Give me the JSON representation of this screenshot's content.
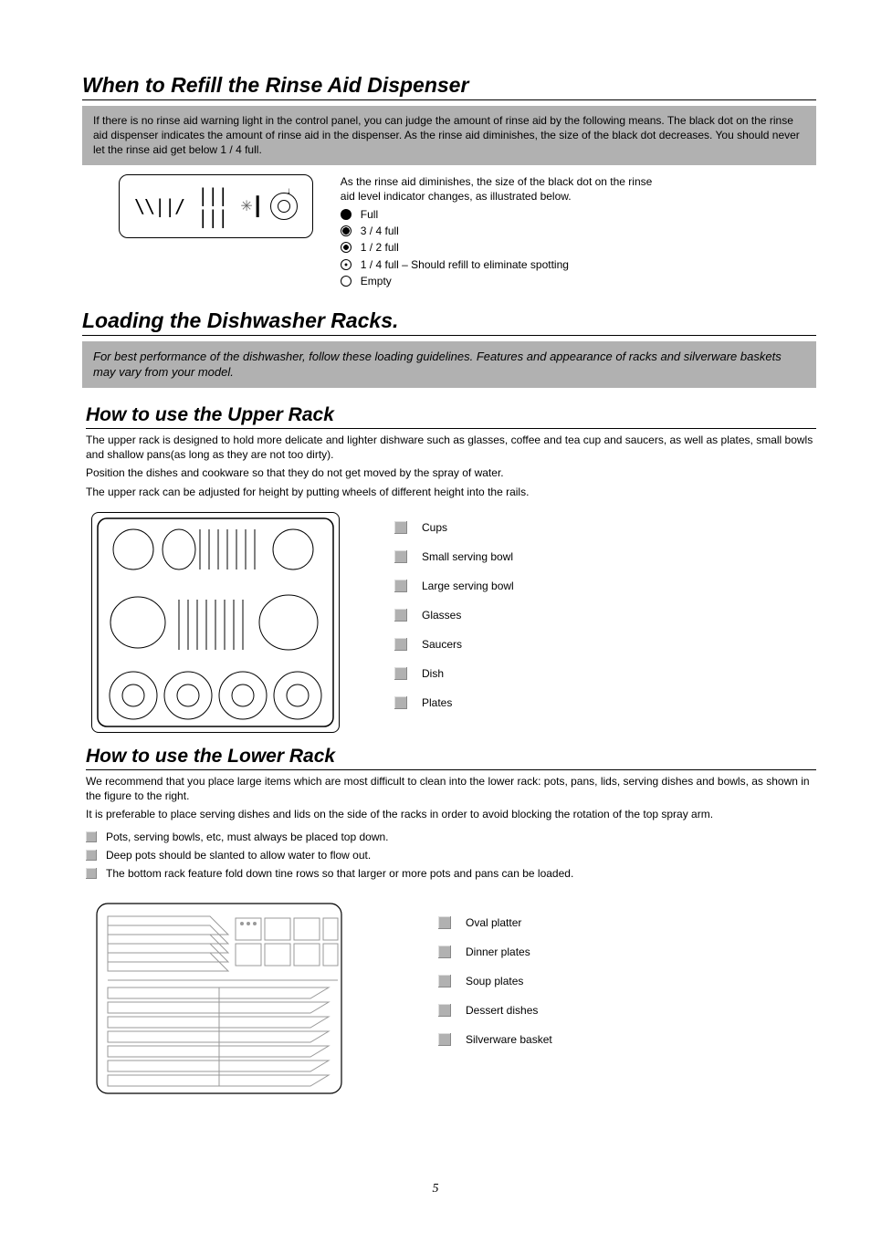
{
  "page_number": "5",
  "sections": {
    "rinse": {
      "heading": "When to Refill the Rinse Aid Dispenser",
      "bar_text": "If there is no rinse aid warning light in the control panel, you can judge the amount of rinse aid by the following means. The black dot on the rinse aid dispenser indicates the amount of rinse aid in the dispenser. As the rinse aid diminishes, the size of the black dot decreases. You should never let the rinse aid get below 1 / 4 full.",
      "side_text": "As the rinse aid diminishes, the size of the black dot on the rinse aid level indicator changes, as illustrated below.",
      "indicators": [
        {
          "label": "Full",
          "class": "ind-full"
        },
        {
          "label": "3 / 4 full",
          "class": "ind-34"
        },
        {
          "label": "1 / 2 full",
          "class": "ind-12"
        },
        {
          "label": "1 / 4 full – Should refill to eliminate spotting",
          "class": "ind-14"
        },
        {
          "label": "Empty",
          "class": "ind-empty"
        }
      ]
    },
    "loading": {
      "heading": "Loading the Dishwasher Racks.",
      "bar_text": "For best performance of the dishwasher, follow these loading guidelines. Features and appearance of racks and  silverware baskets may vary from your model."
    },
    "upper": {
      "heading": "How to use the Upper Rack",
      "p1": "The upper rack is designed to hold more delicate and lighter dishware such as glasses, coffee and tea cup and saucers,  as well as plates, small bowls and shallow pans(as long as they are not too dirty).",
      "p2": "Position the dishes and cookware so that they do not get moved by the spray of water.",
      "p3": "The upper rack can be adjusted for height by putting wheels of different height into the rails.",
      "legend": [
        "Cups",
        "Small serving bowl",
        "Large serving bowl",
        "Glasses",
        "Saucers",
        "Dish",
        "Plates"
      ]
    },
    "lower": {
      "heading": "How to use the Lower Rack",
      "p1": "We recommend that you place large items which are  most  difficult to clean into the lower rack: pots, pans, lids, serving  dishes and bowls, as shown in the figure to the right.",
      "p2": "It is preferable to place serving dishes and lids on the side of  the racks in order to avoid blocking the rotation of the top spray arm.",
      "bullets": [
        "Pots, serving bowls, etc, must always be placed top down.",
        "Deep pots should be slanted to allow water to flow out.",
        "The bottom rack feature fold down tine rows so that larger or more pots and pans can be loaded."
      ],
      "legend": [
        "Oval platter",
        "Dinner plates",
        "Soup plates",
        "Dessert dishes",
        "Silverware  basket"
      ]
    }
  }
}
